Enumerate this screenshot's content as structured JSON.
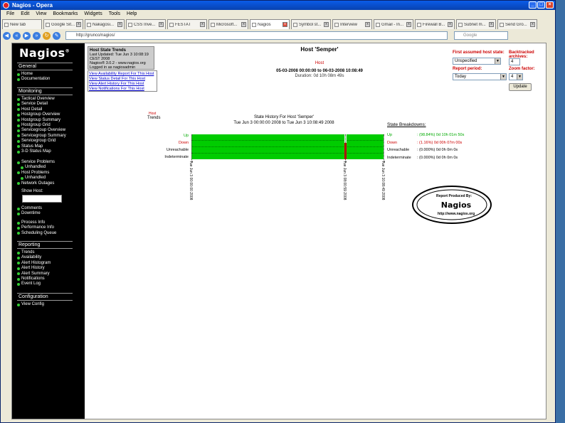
{
  "window": {
    "title": "Nagios - Opera"
  },
  "menu": [
    "File",
    "Edit",
    "View",
    "Bookmarks",
    "Widgets",
    "Tools",
    "Help"
  ],
  "tabs": [
    {
      "label": "New tab"
    },
    {
      "label": "Google Sit..."
    },
    {
      "label": "Nakagosi..."
    },
    {
      "label": "CSS Inve..."
    },
    {
      "label": "FESTAT"
    },
    {
      "label": "Microsoft..."
    },
    {
      "label": "Nagios",
      "active": true
    },
    {
      "label": "Symbol st..."
    },
    {
      "label": "Interview"
    },
    {
      "label": "Gmail - In..."
    },
    {
      "label": "Firewall B..."
    },
    {
      "label": "Subnet m..."
    },
    {
      "label": "Send Gro..."
    }
  ],
  "address": {
    "url": "http://grunco/nagios/",
    "search_placeholder": "Google"
  },
  "sidebar": {
    "logo": "Nagios",
    "logo_mark": "®",
    "sections": {
      "general": "General",
      "monitoring": "Monitoring",
      "reporting": "Reporting",
      "configuration": "Configuration"
    },
    "general_items": [
      "Home",
      "Documentation"
    ],
    "monitoring_items": [
      "Tactical Overview",
      "Service Detail",
      "Host Detail",
      "Hostgroup Overview",
      "Hostgroup Summary",
      "Hostgroup Grid",
      "Servicegroup Overview",
      "Servicegroup Summary",
      "Servicegroup Grid",
      "Status Map",
      "3-D Status Map"
    ],
    "problem_items": [
      "Service Problems",
      "Unhandled",
      "Host Problems",
      "Unhandled",
      "Network Outages"
    ],
    "show_host_label": "Show Host:",
    "misc_items": [
      "Comments",
      "Downtime"
    ],
    "process_items": [
      "Process Info",
      "Performance Info",
      "Scheduling Queue"
    ],
    "reporting_items": [
      "Trends",
      "Availability",
      "Alert Histogram",
      "Alert History",
      "Alert Summary",
      "Notifications",
      "Event Log"
    ],
    "config_items": [
      "View Config"
    ]
  },
  "info": {
    "title": "Host State Trends",
    "line1": "Last Updated: Tue Jun 3 10:08:19 CEST 2008",
    "line2": "Nagios® 3.0.2 - www.nagios.org",
    "line3": "Logged in as nagiosadmin"
  },
  "links": [
    "View Availability Report For This Host",
    "View Status Detail For This Host",
    "View Alert History For This Host",
    "View Notifications For This Host"
  ],
  "header": {
    "title": "Host 'Semper'",
    "sub": "Host",
    "dates": "05-03-2008 00:00:00 to 06-03-2008 10:08:49",
    "duration": "Duration: 0d 10h 08m 49s"
  },
  "options": {
    "first_state_label": "First assumed host state:",
    "first_state_value": "Unspecified",
    "backtrack_label": "Backtracked archives:",
    "backtrack_value": "4",
    "period_label": "Report period:",
    "period_value": "Today",
    "zoom_label": "Zoom factor:",
    "zoom_value": "4",
    "update_button": "Update"
  },
  "trends_label": {
    "small": "Host",
    "main": "Trends"
  },
  "chart_title": {
    "line1": "State History For Host 'Semper'",
    "line2": "Tue Jun 3 00:00:00 2008 to Tue Jun 3 10:08:49 2008"
  },
  "chart_data": {
    "type": "timeline",
    "states": [
      "Up",
      "Down",
      "Unreachable",
      "Indeterminate"
    ],
    "segments": [
      {
        "state": "Up",
        "start": "00:00:00",
        "end": "08:00:00"
      },
      {
        "state": "Down",
        "start": "08:00:00",
        "end": "08:07:00"
      },
      {
        "state": "Up",
        "start": "08:07:00",
        "end": "10:08:49"
      }
    ],
    "ticks": [
      "Tue Jun 3 00:00:00 2008",
      "Tue Jun 3 08:00:59 2008",
      "Tue Jun 3 10:08:49 2008"
    ]
  },
  "breakdowns": {
    "title": "State Breakdowns:",
    "rows": [
      {
        "label": "Up",
        "value": ": (98.84%) 0d 10h 01m 50s",
        "color": "#00aa00"
      },
      {
        "label": "Down",
        "value": ": (1.16%) 0d 00h 07m 00s",
        "color": "#cc0000"
      },
      {
        "label": "Unreachable",
        "value": ": (0.000%) 0d 0h 0m 0s",
        "color": "#000000"
      },
      {
        "label": "Indeterminate",
        "value": ": (0.000%) 0d 0h 0m 0s",
        "color": "#000000"
      }
    ]
  },
  "badge": {
    "line1": "Report Produced By:",
    "line2": "Nagios",
    "line3": "http://www.nagios.org"
  },
  "colors": {
    "up": "#00cc00",
    "down": "#cc0000",
    "sidebar": "#000000"
  }
}
